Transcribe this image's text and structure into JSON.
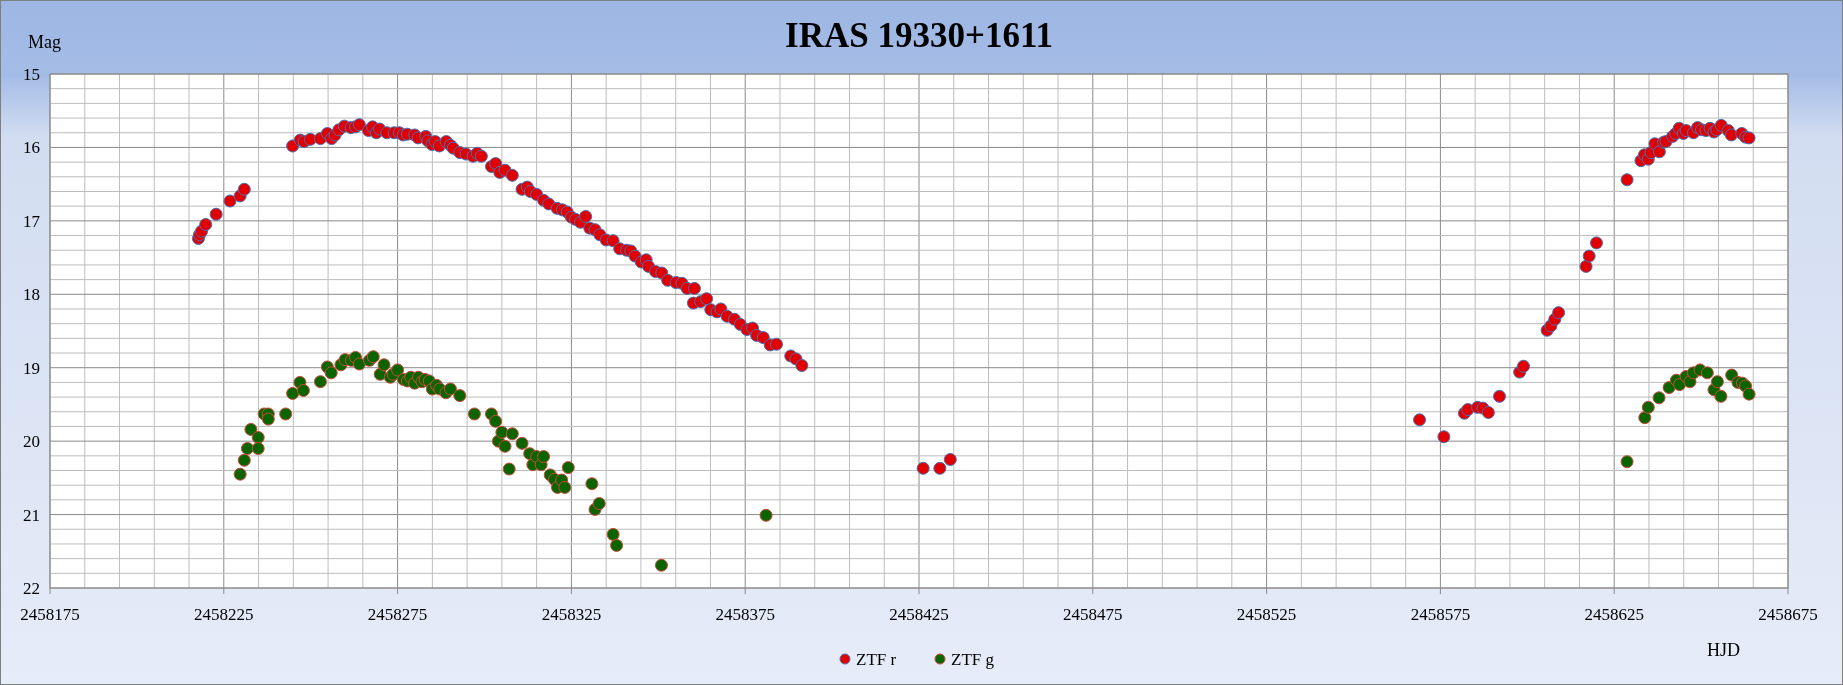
{
  "chart": {
    "chart_data": {
      "type": "scatter",
      "title": "IRAS 19330+1611",
      "xlabel": "HJD",
      "ylabel": "Mag",
      "xlim": [
        2458175,
        2458675
      ],
      "ylim": [
        22,
        15
      ],
      "grid": true,
      "legend": "bottom",
      "xticks": [
        2458175,
        2458225,
        2458275,
        2458325,
        2458375,
        2458425,
        2458475,
        2458525,
        2458575,
        2458625,
        2458675
      ],
      "yticks": [
        15,
        16,
        17,
        18,
        19,
        20,
        21,
        22
      ],
      "series": [
        {
          "name": "ZTF r",
          "color": "#e00000",
          "x": [
            2458217.7,
            2458218.0,
            2458218.6,
            2458219.8,
            2458222.8,
            2458226.8,
            2458229.7,
            2458230.9,
            2458244.8,
            2458247.0,
            2458248.1,
            2458249.9,
            2458252.8,
            2458254.8,
            2458256.0,
            2458257.0,
            2458258.1,
            2458259.7,
            2458261.6,
            2458262.9,
            2458264.0,
            2458266.6,
            2458267.8,
            2458268.9,
            2458269.8,
            2458271.9,
            2458274.0,
            2458275.5,
            2458276.6,
            2458277.8,
            2458279.9,
            2458280.9,
            2458283.1,
            2458283.7,
            2458284.9,
            2458285.8,
            2458287.0,
            2458289.0,
            2458290.2,
            2458291.0,
            2458292.9,
            2458294.7,
            2458296.7,
            2458297.9,
            2458299.1,
            2458302.0,
            2458303.2,
            2458304.4,
            2458305.9,
            2458308.0,
            2458310.8,
            2458312.3,
            2458313.2,
            2458315.0,
            2458317.0,
            2458318.5,
            2458320.9,
            2458322.4,
            2458323.8,
            2458325.0,
            2458326.2,
            2458327.6,
            2458329.1,
            2458330.3,
            2458331.8,
            2458333.2,
            2458335.0,
            2458337.0,
            2458338.9,
            2458340.9,
            2458342.1,
            2458343.3,
            2458345.1,
            2458346.5,
            2458347.2,
            2458349.2,
            2458351.0,
            2458352.7,
            2458355.1,
            2458356.8,
            2458358.3,
            2458360.4,
            2458360.1,
            2458362.2,
            2458363.9,
            2458365.1,
            2458366.9,
            2458368.0,
            2458369.8,
            2458371.9,
            2458373.6,
            2458375.5,
            2458377.1,
            2458378.3,
            2458380.2,
            2458382.2,
            2458384.0,
            2458388.1,
            2458389.6,
            2458391.3,
            2458426.2,
            2458431.0,
            2458434.0,
            2458569.0,
            2458576.0,
            2458581.9,
            2458582.9,
            2458585.7,
            2458587.2,
            2458588.8,
            2458592.0,
            2458597.8,
            2458598.9,
            2458605.7,
            2458606.8,
            2458607.9,
            2458609.0,
            2458616.9,
            2458617.8,
            2458619.9,
            2458628.7,
            2458632.7,
            2458633.7,
            2458634.8,
            2458635.6,
            2458636.7,
            2458638.0,
            2458639.2,
            2458639.9,
            2458641.8,
            2458642.7,
            2458643.7,
            2458644.9,
            2458645.7,
            2458647.8,
            2458649.0,
            2458650.1,
            2458651.4,
            2458652.6,
            2458653.7,
            2458654.5,
            2458655.8,
            2458657.8,
            2458658.7,
            2458661.7,
            2458662.8,
            2458663.8
          ],
          "values": [
            17.24,
            17.19,
            17.14,
            17.05,
            16.91,
            16.73,
            16.66,
            16.57,
            15.98,
            15.9,
            15.92,
            15.89,
            15.88,
            15.81,
            15.88,
            15.83,
            15.76,
            15.71,
            15.73,
            15.72,
            15.69,
            15.77,
            15.72,
            15.8,
            15.75,
            15.8,
            15.8,
            15.8,
            15.83,
            15.82,
            15.83,
            15.87,
            15.85,
            15.91,
            15.96,
            15.92,
            15.98,
            15.92,
            15.97,
            16.01,
            16.07,
            16.09,
            16.12,
            16.08,
            16.12,
            16.26,
            16.22,
            16.34,
            16.31,
            16.38,
            16.57,
            16.54,
            16.6,
            16.64,
            16.72,
            16.77,
            16.83,
            16.85,
            16.88,
            16.95,
            16.98,
            17.02,
            16.94,
            17.1,
            17.12,
            17.19,
            17.26,
            17.27,
            17.38,
            17.4,
            17.41,
            17.48,
            17.56,
            17.53,
            17.62,
            17.69,
            17.71,
            17.81,
            17.84,
            17.85,
            17.92,
            17.92,
            18.12,
            18.1,
            18.06,
            18.21,
            18.24,
            18.2,
            18.3,
            18.34,
            18.41,
            18.48,
            18.46,
            18.56,
            18.59,
            18.69,
            18.68,
            18.84,
            18.88,
            18.97,
            20.37,
            20.37,
            20.25,
            19.71,
            19.94,
            19.62,
            19.57,
            19.54,
            19.55,
            19.61,
            19.39,
            19.06,
            18.98,
            18.49,
            18.43,
            18.34,
            18.25,
            17.62,
            17.48,
            17.3,
            16.44,
            16.18,
            16.1,
            16.16,
            16.07,
            15.95,
            16.06,
            15.93,
            15.92,
            15.85,
            15.81,
            15.74,
            15.81,
            15.77,
            15.8,
            15.73,
            15.76,
            15.77,
            15.74,
            15.79,
            15.76,
            15.7,
            15.77,
            15.83,
            15.81,
            15.86,
            15.87
          ]
        },
        {
          "name": "ZTF g",
          "color": "#0b6400",
          "x": [
            2458229.7,
            2458230.9,
            2458231.8,
            2458232.8,
            2458234.9,
            2458234.9,
            2458236.6,
            2458237.8,
            2458237.8,
            2458242.8,
            2458244.8,
            2458246.9,
            2458247.9,
            2458252.8,
            2458254.8,
            2458255.9,
            2458258.7,
            2458259.9,
            2458261.7,
            2458262.9,
            2458264.0,
            2458266.9,
            2458268.0,
            2458270.0,
            2458271.1,
            2458272.9,
            2458273.7,
            2458275.0,
            2458276.7,
            2458277.8,
            2458278.8,
            2458279.9,
            2458281.0,
            2458282.0,
            2458282.9,
            2458284.1,
            2458285.0,
            2458286.2,
            2458287.1,
            2458288.9,
            2458290.2,
            2458292.9,
            2458297.1,
            2458302.0,
            2458303.2,
            2458304.0,
            2458305.0,
            2458305.9,
            2458307.1,
            2458308.0,
            2458310.8,
            2458313.0,
            2458313.9,
            2458315.0,
            2458316.3,
            2458317.0,
            2458318.9,
            2458320.1,
            2458321.0,
            2458322.2,
            2458323.1,
            2458324.1,
            2458330.9,
            2458331.8,
            2458333.0,
            2458337.0,
            2458338.0,
            2458350.9,
            2458381.0,
            2458628.7,
            2458633.8,
            2458634.8,
            2458637.9,
            2458640.8,
            2458642.9,
            2458643.8,
            2458645.7,
            2458646.8,
            2458647.8,
            2458649.7,
            2458651.8,
            2458653.7,
            2458654.7,
            2458655.7,
            2458658.8,
            2458660.6,
            2458661.9,
            2458662.8,
            2458663.8
          ],
          "values": [
            20.45,
            20.26,
            20.1,
            19.84,
            19.95,
            20.1,
            19.63,
            19.63,
            19.7,
            19.63,
            19.35,
            19.2,
            19.31,
            19.19,
            18.99,
            19.07,
            18.96,
            18.89,
            18.9,
            18.86,
            18.95,
            18.9,
            18.85,
            19.09,
            18.96,
            19.13,
            19.09,
            19.03,
            19.16,
            19.18,
            19.13,
            19.21,
            19.13,
            19.19,
            19.16,
            19.18,
            19.29,
            19.24,
            19.29,
            19.34,
            19.29,
            19.38,
            19.63,
            19.63,
            19.73,
            20.0,
            19.88,
            20.07,
            20.38,
            19.9,
            20.03,
            20.17,
            20.32,
            20.21,
            20.32,
            20.21,
            20.46,
            20.52,
            20.63,
            20.53,
            20.63,
            20.36,
            20.58,
            20.93,
            20.85,
            21.27,
            21.42,
            21.69,
            21.01,
            20.28,
            19.68,
            19.54,
            19.41,
            19.27,
            19.17,
            19.23,
            19.12,
            19.19,
            19.07,
            19.03,
            19.07,
            19.3,
            19.19,
            19.39,
            19.1,
            19.2,
            19.21,
            19.25,
            19.36
          ]
        }
      ]
    }
  }
}
